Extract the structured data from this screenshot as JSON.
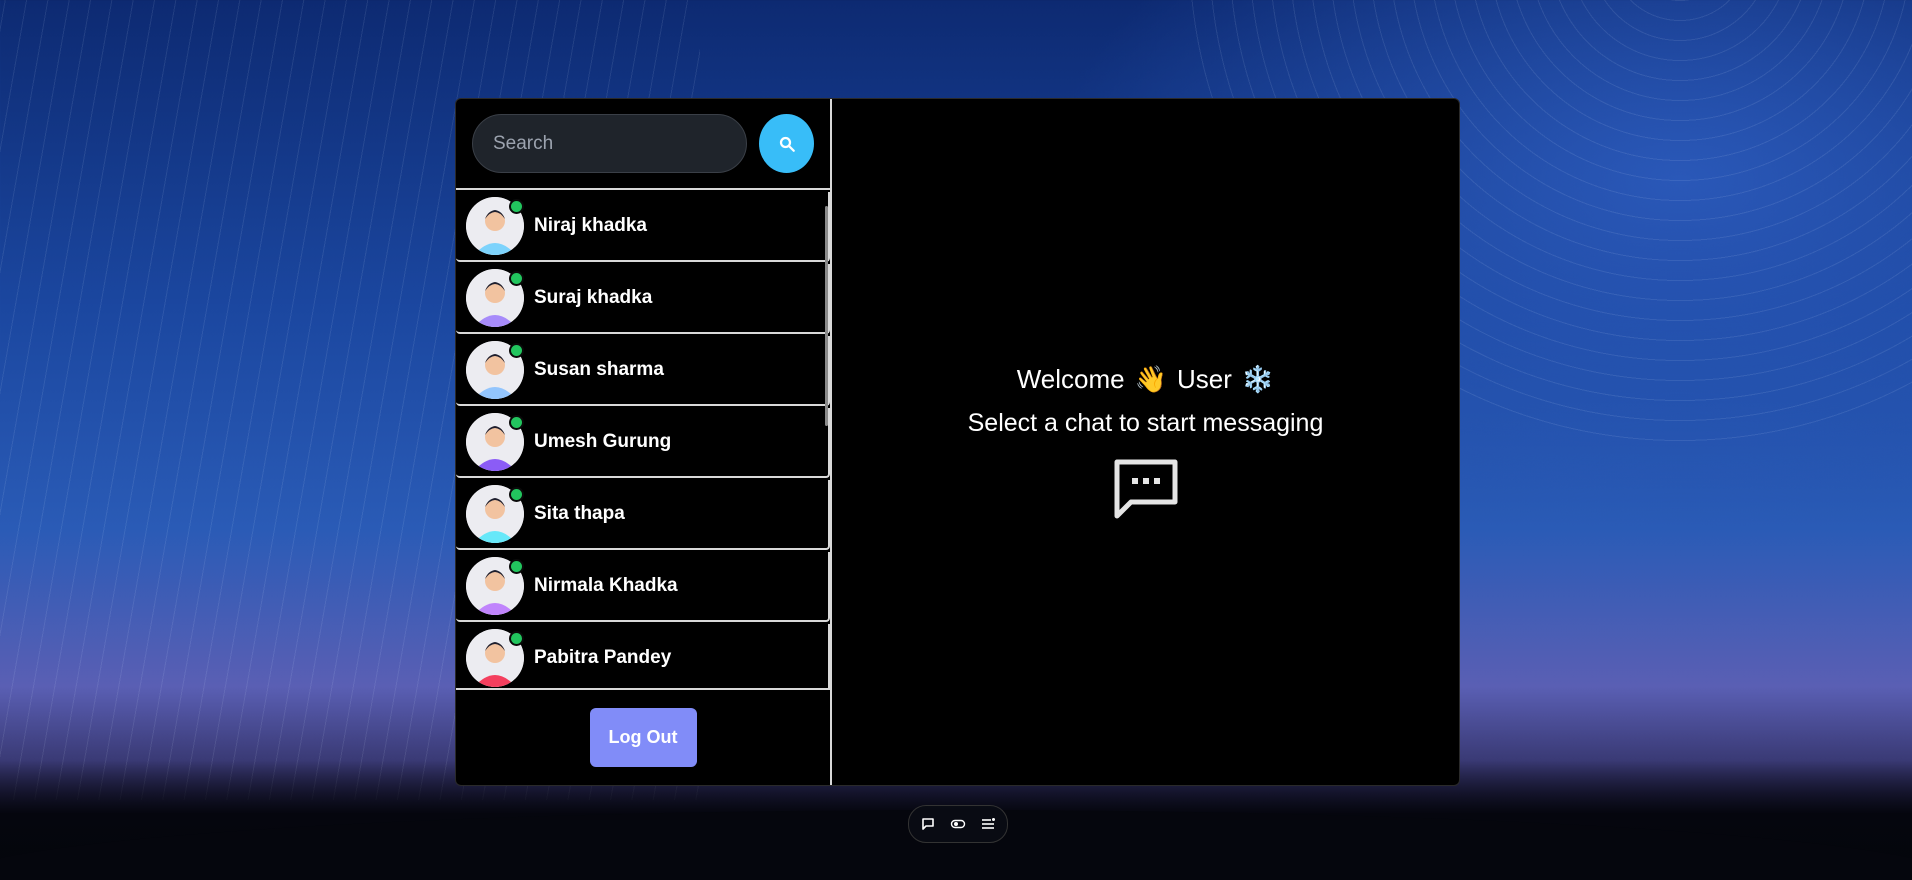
{
  "search": {
    "placeholder": "Search",
    "button_icon": "search-icon"
  },
  "chats": [
    {
      "name": "Niraj khadka",
      "online": true,
      "avatar_color": "#7dd3fc"
    },
    {
      "name": "Suraj khadka",
      "online": true,
      "avatar_color": "#a78bfa"
    },
    {
      "name": "Susan sharma",
      "online": true,
      "avatar_color": "#93c5fd"
    },
    {
      "name": "Umesh Gurung",
      "online": true,
      "avatar_color": "#8b5cf6"
    },
    {
      "name": "Sita thapa",
      "online": true,
      "avatar_color": "#67e8f9"
    },
    {
      "name": "Nirmala Khadka",
      "online": true,
      "avatar_color": "#c084fc"
    },
    {
      "name": "Pabitra Pandey",
      "online": true,
      "avatar_color": "#f43f5e"
    }
  ],
  "logout": {
    "label": "Log Out"
  },
  "welcome": {
    "greeting": "Welcome",
    "wave_emoji": "👋",
    "user": "User",
    "snow_emoji": "❄️",
    "prompt": "Select a chat to start messaging",
    "icon": "chat-bubble-icon"
  },
  "taskbar": {
    "icons": [
      "message-icon",
      "toggle-icon",
      "list-icon"
    ]
  },
  "colors": {
    "accent": "#38bdf8",
    "logout": "#818cf8",
    "online": "#22c55e",
    "panel": "#000000"
  }
}
